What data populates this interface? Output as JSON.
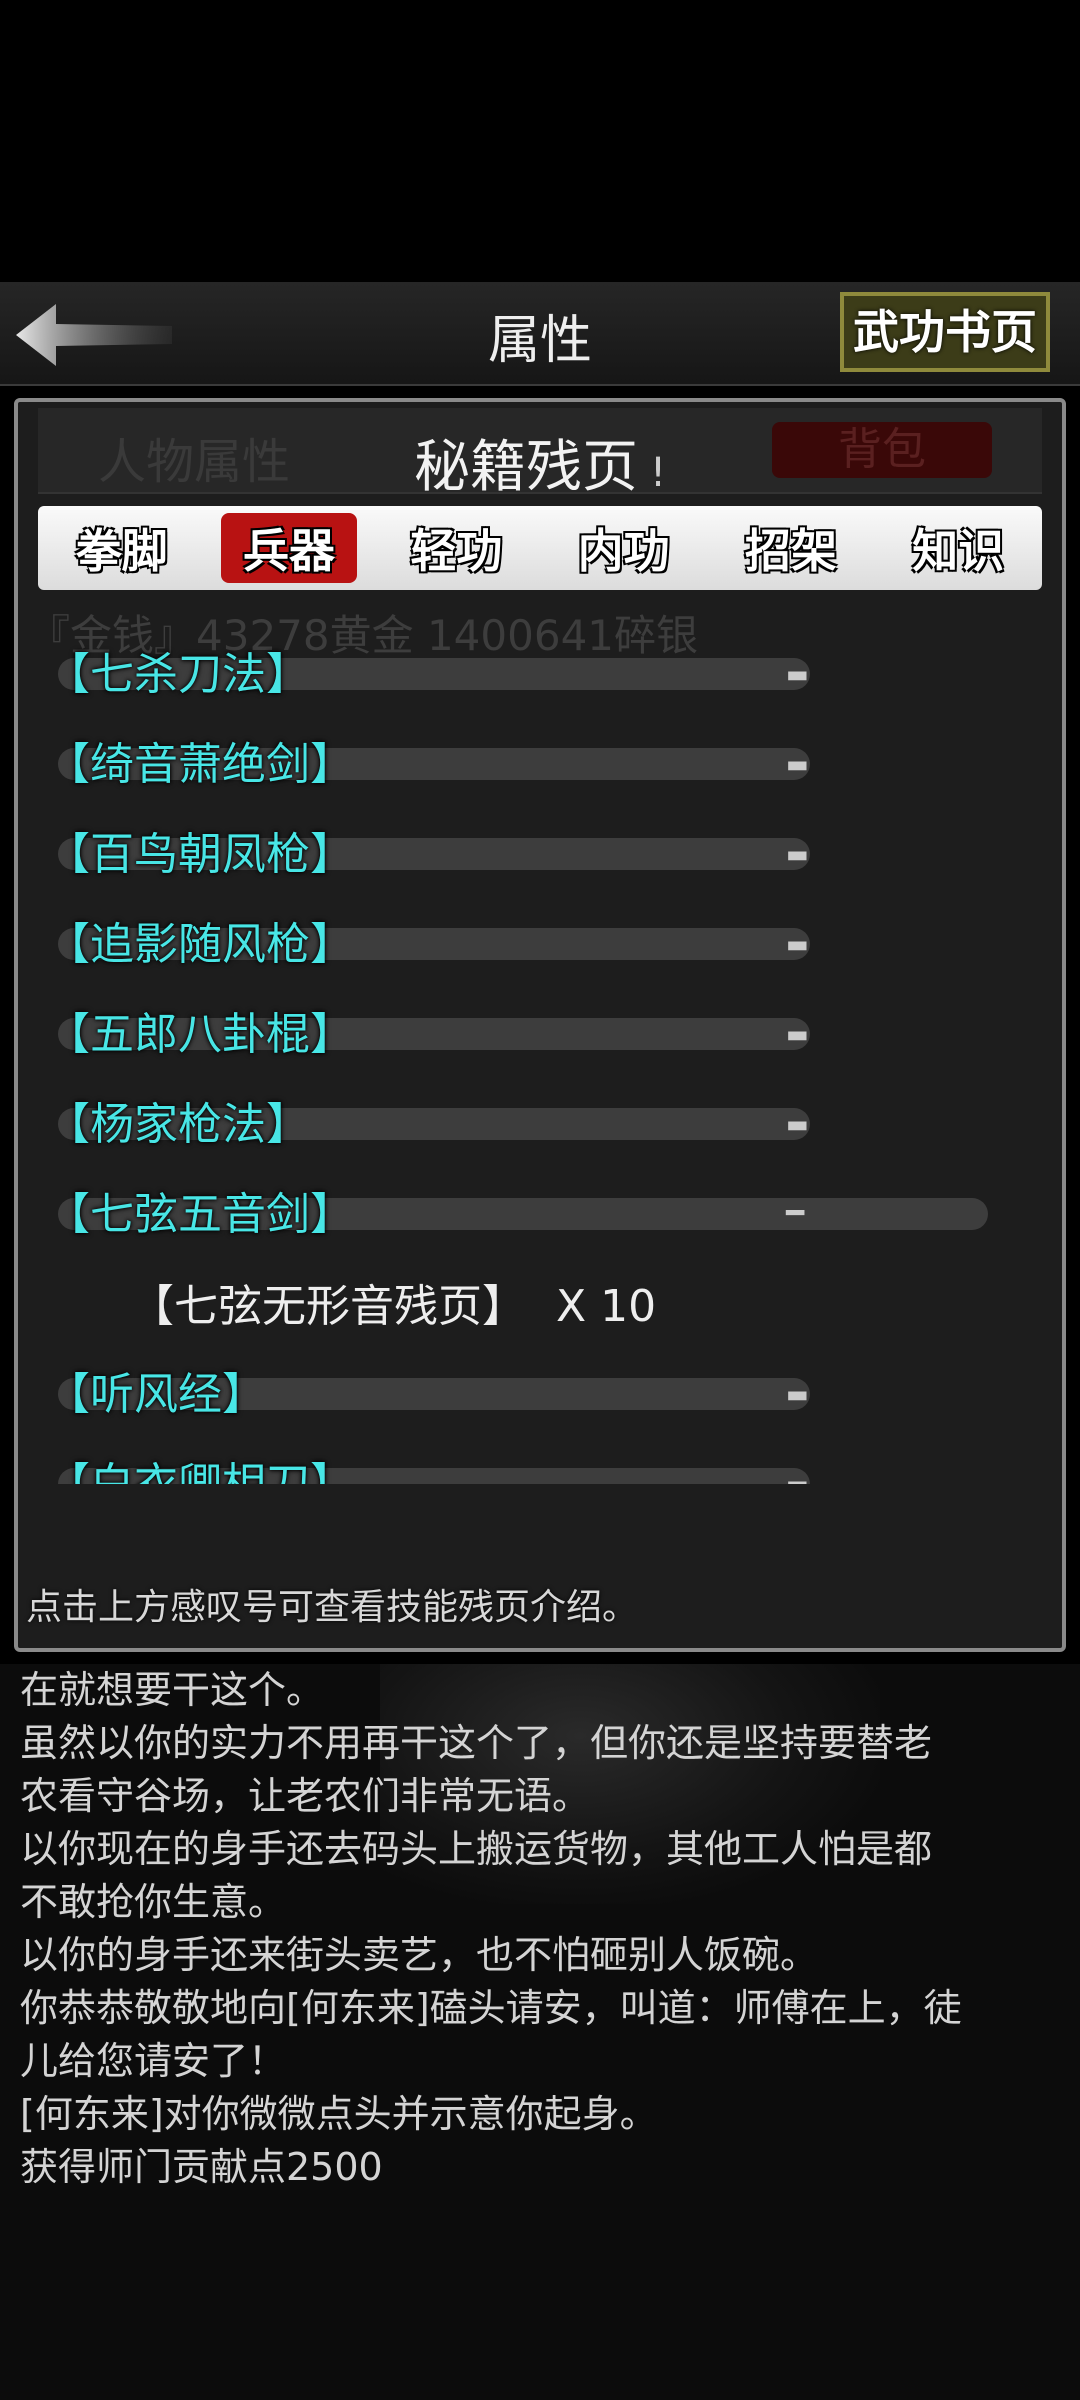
{
  "topbar": {
    "title": "属性",
    "wugong_button": "武功书页"
  },
  "panel": {
    "header": {
      "left_tab": "人物属性",
      "title": "秘籍残页",
      "info_mark": "!",
      "right_tab": "背包"
    },
    "tabs": [
      {
        "label": "拳脚",
        "active": false
      },
      {
        "label": "兵器",
        "active": true
      },
      {
        "label": "轻功",
        "active": false
      },
      {
        "label": "内功",
        "active": false
      },
      {
        "label": "招架",
        "active": false
      },
      {
        "label": "知识",
        "active": false
      }
    ],
    "background_money": "『金钱』43278黄金 1400641碎银",
    "list": [
      {
        "name": "【七杀刀法】",
        "expanded": false
      },
      {
        "name": "【绮音萧绝剑】",
        "expanded": false
      },
      {
        "name": "【百鸟朝凤枪】",
        "expanded": false
      },
      {
        "name": "【追影随风枪】",
        "expanded": false
      },
      {
        "name": "【五郎八卦棍】",
        "expanded": false
      },
      {
        "name": "【杨家枪法】",
        "expanded": false
      },
      {
        "name": "【七弦五音剑】",
        "expanded": true
      },
      {
        "name": "【听风经】",
        "expanded": false
      },
      {
        "name": "【白衣卿相刀】",
        "expanded": false
      }
    ],
    "expanded_detail": {
      "page": "【七弦无形音残页】",
      "count": "X 10"
    },
    "hint": "点击上方感叹号可查看技能残页介绍。"
  },
  "log": [
    "在就想要干这个。",
    "虽然以你的实力不用再干这个了，但你还是坚持要替老",
    "农看守谷场，让老农们非常无语。",
    "以你现在的身手还去码头上搬运货物，其他工人怕是都",
    "不敢抢你生意。",
    "以你的身手还来街头卖艺，也不怕砸别人饭碗。",
    "你恭恭敬敬地向[何东来]磕头请安，叫道：师傅在上，徒",
    "儿给您请安了！",
    "[何东来]对你微微点头并示意你起身。",
    "获得师门贡献点2500"
  ],
  "colors": {
    "skill_name": "#48e6e6",
    "active_tab": "#b81212",
    "button_border": "#8f8a3c"
  },
  "icons": {
    "back": "left-arrow-icon",
    "collapsed": "chevron-down-icon",
    "expanded": "minus-icon"
  }
}
